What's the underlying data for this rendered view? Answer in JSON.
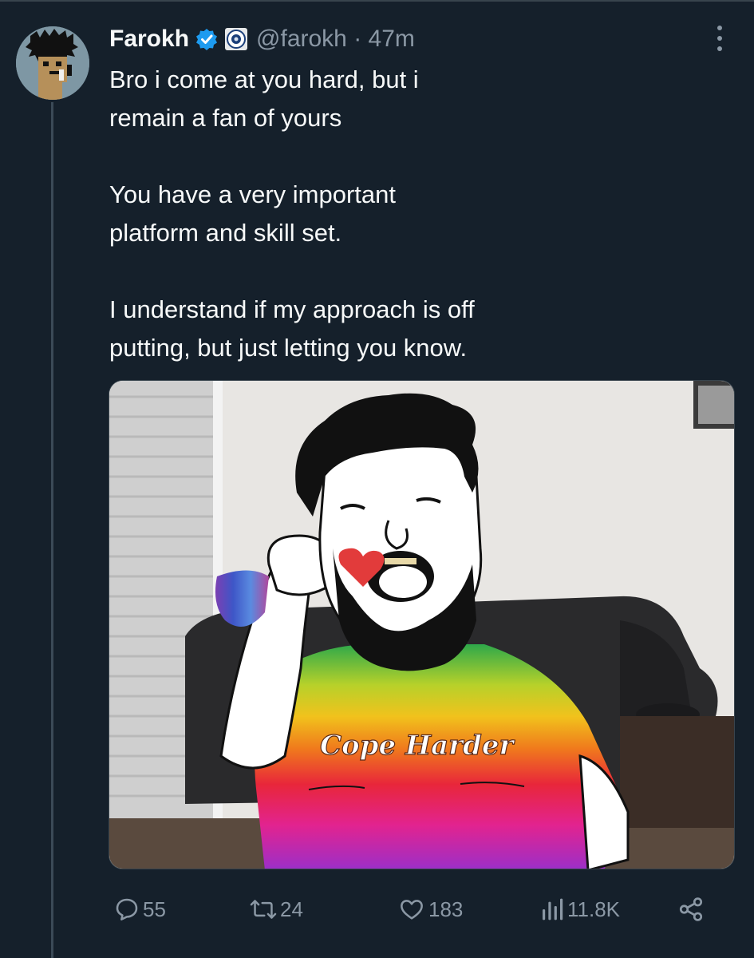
{
  "tweet": {
    "author_name": "Farokh",
    "handle_time": "@farokh · 47m",
    "paragraphs": [
      "Bro i come at you hard, but i\nremain a fan of yours",
      "You have a very important\nplatform and skill set.",
      "I understand if my approach is off\nputting, but just letting you know."
    ],
    "image_caption_text": "Cope Harder"
  },
  "actions": {
    "replies": "55",
    "reposts": "24",
    "likes": "183",
    "views": "11.8K"
  },
  "icons": {
    "verified": "verified-badge-icon",
    "affiliate": "affiliate-badge-icon",
    "more": "more-options-icon",
    "reply": "reply-icon",
    "repost": "repost-icon",
    "like": "heart-icon",
    "views": "views-icon",
    "share": "share-icon"
  },
  "colors": {
    "background": "#15202b",
    "text": "#f7f9f9",
    "muted": "#8b98a5",
    "verified": "#1d9bf0"
  }
}
